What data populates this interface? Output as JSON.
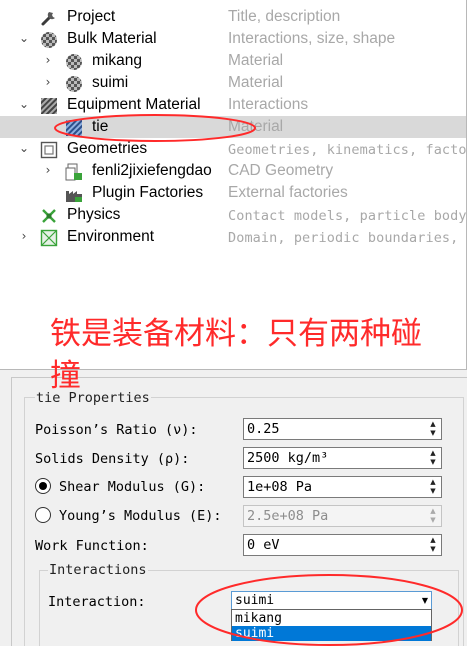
{
  "tree": {
    "rows": [
      {
        "name": "Project",
        "desc": "Title, description",
        "icon": "wrench-icon"
      },
      {
        "name": "Bulk Material",
        "desc": "Interactions, size, shape",
        "icon": "bulk-material-icon"
      },
      {
        "name": "mikang",
        "desc": "Material",
        "icon": "particle-material-icon"
      },
      {
        "name": "suimi",
        "desc": "Material",
        "icon": "particle-material-icon"
      },
      {
        "name": "Equipment Material",
        "desc": "Interactions",
        "icon": "equipment-material-icon"
      },
      {
        "name": "tie",
        "desc": "Material",
        "icon": "equipment-material-icon"
      },
      {
        "name": "Geometries",
        "desc": "Geometries, kinematics, factor",
        "icon": "geometry-icon"
      },
      {
        "name": "fenli2jixiefengdao",
        "desc": "CAD Geometry",
        "icon": "cad-geometry-icon"
      },
      {
        "name": "Plugin Factories",
        "desc": "External factories",
        "icon": "plugin-factory-icon"
      },
      {
        "name": "Physics",
        "desc": "Contact models, particle body",
        "icon": "physics-icon"
      },
      {
        "name": "Environment",
        "desc": "Domain, periodic boundaries, ",
        "icon": "environment-icon"
      }
    ]
  },
  "annotation": {
    "text": "铁是装备材料：只有两种碰撞",
    "color": "#ff2a2a"
  },
  "properties": {
    "group_title": "tie Properties",
    "poisson_label": "Poisson’s Ratio (ν):",
    "poisson_value": "0.25",
    "density_label": "Solids Density (ρ):",
    "density_value": "2500 kg/m³",
    "shear_label": "Shear Modulus (G):",
    "shear_value": "1e+08 Pa",
    "young_label": "Young’s Modulus (E):",
    "young_value": "2.5e+08 Pa",
    "work_label": "Work Function:",
    "work_value": "0 eV",
    "interactions_title": "Interactions",
    "interaction_label": "Interaction:",
    "interaction_value": "suimi",
    "interaction_options": [
      "mikang",
      "suimi"
    ],
    "interaction_selected": "suimi"
  },
  "colors": {
    "selected_row": "#d9d9d9",
    "dropdown_highlight": "#0078d7",
    "annotation_red": "#ff2a2a",
    "description_gray": "#a8a8a8"
  }
}
